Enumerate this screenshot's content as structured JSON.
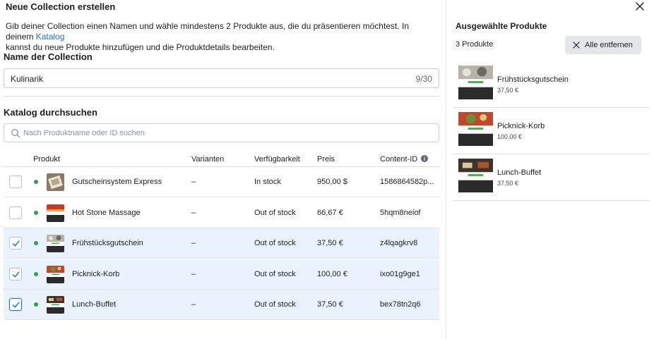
{
  "dialog": {
    "title": "Neue Collection erstellen",
    "description_prefix": "Gib deiner Collection einen Namen und wähle mindestens 2 Produkte aus, die du präsentieren möchtest. In deinem ",
    "description_link": "Katalog",
    "description_suffix": "kannst du neue Produkte hinzufügen und die Produktdetails bearbeiten."
  },
  "name_section": {
    "label": "Name der Collection",
    "value": "Kulinarik",
    "char_count": "9/30"
  },
  "catalog_section": {
    "label": "Katalog durchsuchen",
    "search_placeholder": "Nach Produktname oder ID suchen"
  },
  "table": {
    "headers": {
      "product": "Produkt",
      "variants": "Varianten",
      "availability": "Verfügbarkeit",
      "price": "Preis",
      "content_id": "Content-ID"
    },
    "rows": [
      {
        "name": "Gutscheinsystem Express",
        "variants": "–",
        "availability": "In stock",
        "price": "950,00 $",
        "content_id": "1586864582p...",
        "selected": false,
        "thumb": "voucher"
      },
      {
        "name": "Hot Stone Massage",
        "variants": "–",
        "availability": "Out of stock",
        "price": "66,67 €",
        "content_id": "5hqm8neiof",
        "selected": false,
        "thumb": "flag"
      },
      {
        "name": "Frühstücksgutschein",
        "variants": "–",
        "availability": "Out of stock",
        "price": "37,50 €",
        "content_id": "z4lqagkrv8",
        "selected": true,
        "thumb": "breakfast"
      },
      {
        "name": "Picknick-Korb",
        "variants": "–",
        "availability": "Out of stock",
        "price": "100,00 €",
        "content_id": "ixo01g9ge1",
        "selected": true,
        "thumb": "picnic"
      },
      {
        "name": "Lunch-Buffet",
        "variants": "–",
        "availability": "Out of stock",
        "price": "37,50 €",
        "content_id": "bex78tn2q6",
        "selected": true,
        "thumb": "buffet"
      }
    ]
  },
  "selected_panel": {
    "title": "Ausgewählte Produkte",
    "count": "3 Produkte",
    "remove_all_label": "Alle entfernen",
    "items": [
      {
        "name": "Frühstücksgutschein",
        "price": "37,50 €",
        "thumb": "breakfast"
      },
      {
        "name": "Picknick-Korb",
        "price": "100,00 €",
        "thumb": "picnic"
      },
      {
        "name": "Lunch-Buffet",
        "price": "37,50 €",
        "thumb": "buffet"
      }
    ]
  },
  "colors": {
    "accent": "#1877f2",
    "link": "#216fdb",
    "status_dot": "#31a24c",
    "selected_row": "#eaf3fd"
  }
}
